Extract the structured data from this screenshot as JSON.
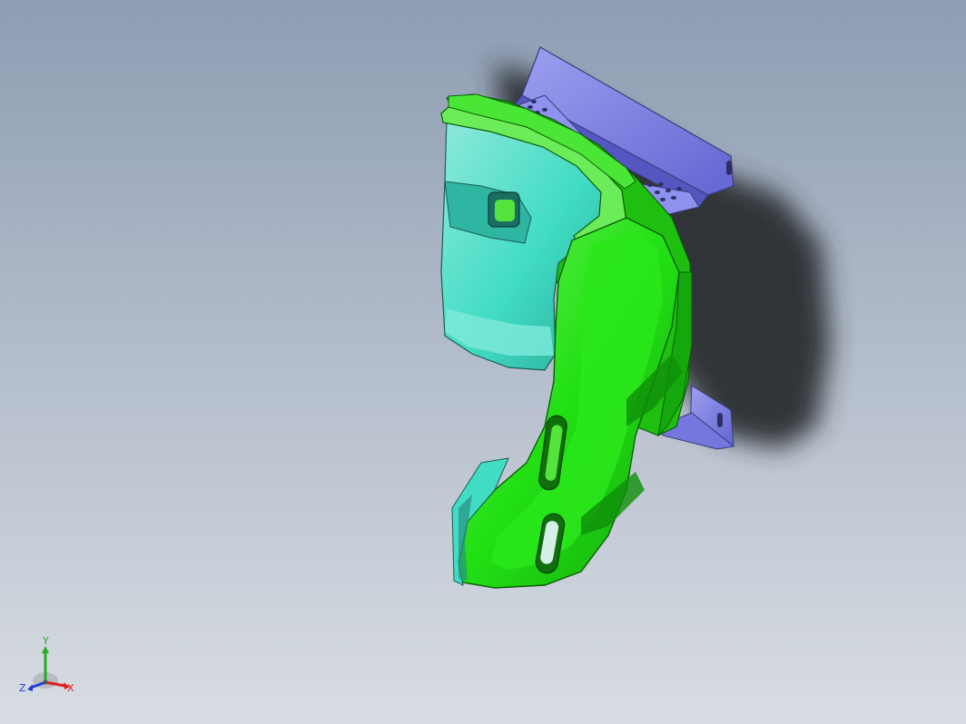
{
  "viewport": {
    "background_top": "#8e9db3",
    "background_bottom": "#d9dde3"
  },
  "model": {
    "seat_shell_color": "#22e014",
    "seat_inner_color": "#40dcc4",
    "bracket_color": "#7d7fe6",
    "shadow_color": "#2a2d33"
  },
  "triad": {
    "x_label": "X",
    "y_label": "Y",
    "z_label": "Z",
    "x_color": "#e02020",
    "y_color": "#20b020",
    "z_color": "#2040d0"
  }
}
